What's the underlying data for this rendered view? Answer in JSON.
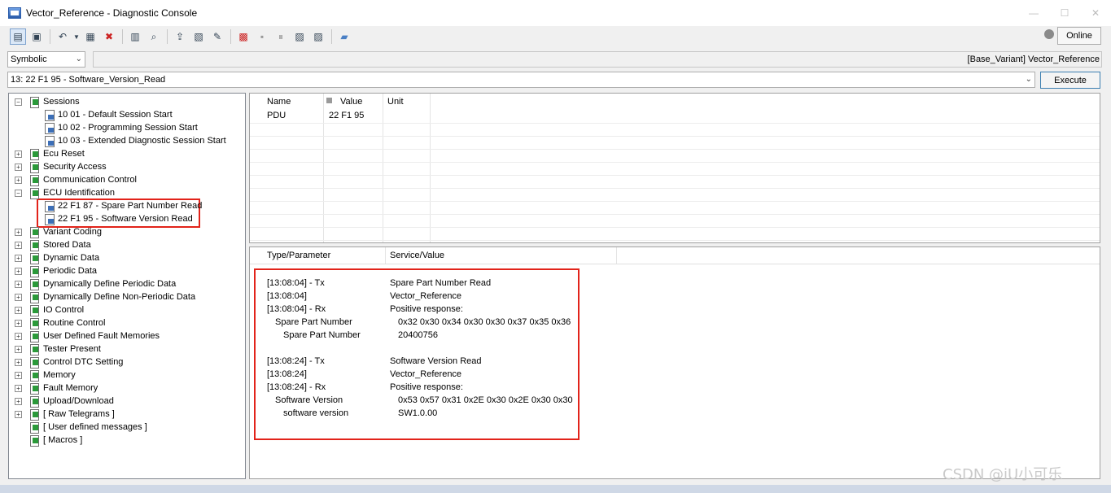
{
  "window": {
    "title": "Vector_Reference - Diagnostic Console"
  },
  "toolbar": {
    "online_label": "Online"
  },
  "selector": {
    "mode": "Symbolic",
    "variant_path": "[Base_Variant] Vector_Reference"
  },
  "service": {
    "current": "13: 22 F1 95 - Software_Version_Read",
    "execute_label": "Execute"
  },
  "tree": [
    {
      "label": "Sessions",
      "level": 0,
      "kind": "folder",
      "expander": "minus"
    },
    {
      "label": "10 01 - Default Session Start",
      "level": 1,
      "kind": "service",
      "expander": ""
    },
    {
      "label": "10 02 - Programming Session Start",
      "level": 1,
      "kind": "service",
      "expander": ""
    },
    {
      "label": "10 03 - Extended Diagnostic Session Start",
      "level": 1,
      "kind": "service",
      "expander": ""
    },
    {
      "label": "Ecu Reset",
      "level": 0,
      "kind": "folder",
      "expander": "plus"
    },
    {
      "label": "Security Access",
      "level": 0,
      "kind": "folder",
      "expander": "plus"
    },
    {
      "label": "Communication Control",
      "level": 0,
      "kind": "folder",
      "expander": "plus"
    },
    {
      "label": "ECU Identification",
      "level": 0,
      "kind": "folder",
      "expander": "minus"
    },
    {
      "label": "22 F1 87 - Spare Part Number Read",
      "level": 1,
      "kind": "service",
      "expander": ""
    },
    {
      "label": "22 F1 95 - Software Version Read",
      "level": 1,
      "kind": "service",
      "expander": ""
    },
    {
      "label": "Variant Coding",
      "level": 0,
      "kind": "folder",
      "expander": "plus"
    },
    {
      "label": "Stored Data",
      "level": 0,
      "kind": "folder",
      "expander": "plus"
    },
    {
      "label": "Dynamic Data",
      "level": 0,
      "kind": "folder",
      "expander": "plus"
    },
    {
      "label": "Periodic Data",
      "level": 0,
      "kind": "folder",
      "expander": "plus"
    },
    {
      "label": "Dynamically Define Periodic Data",
      "level": 0,
      "kind": "folder",
      "expander": "plus"
    },
    {
      "label": "Dynamically Define Non-Periodic Data",
      "level": 0,
      "kind": "folder",
      "expander": "plus"
    },
    {
      "label": "IO Control",
      "level": 0,
      "kind": "folder",
      "expander": "plus"
    },
    {
      "label": "Routine Control",
      "level": 0,
      "kind": "folder",
      "expander": "plus"
    },
    {
      "label": "User Defined Fault Memories",
      "level": 0,
      "kind": "folder",
      "expander": "plus"
    },
    {
      "label": "Tester Present",
      "level": 0,
      "kind": "folder",
      "expander": "plus"
    },
    {
      "label": "Control DTC Setting",
      "level": 0,
      "kind": "folder",
      "expander": "plus"
    },
    {
      "label": "Memory",
      "level": 0,
      "kind": "folder",
      "expander": "plus"
    },
    {
      "label": "Fault Memory",
      "level": 0,
      "kind": "folder",
      "expander": "plus"
    },
    {
      "label": "Upload/Download",
      "level": 0,
      "kind": "folder",
      "expander": "plus"
    },
    {
      "label": "[ Raw Telegrams ]",
      "level": 0,
      "kind": "folder",
      "expander": "plus"
    },
    {
      "label": "[ User defined messages ]",
      "level": 0,
      "kind": "folder",
      "expander": ""
    },
    {
      "label": "[ Macros ]",
      "level": 0,
      "kind": "folder",
      "expander": ""
    }
  ],
  "params_table": {
    "headers": [
      "Name",
      "Value",
      "Unit"
    ],
    "rows": [
      {
        "name": "PDU",
        "value": "22 F1 95",
        "unit": ""
      }
    ]
  },
  "log_table": {
    "headers": [
      "Type/Parameter",
      "Service/Value"
    ],
    "rows": [
      {
        "param": "[13:08:04] - Tx",
        "value": "Spare Part Number Read",
        "indent": 0
      },
      {
        "param": "[13:08:04]",
        "value": "Vector_Reference",
        "indent": 0
      },
      {
        "param": "[13:08:04] - Rx",
        "value": "Positive response:",
        "indent": 0
      },
      {
        "param": "Spare Part Number",
        "value": "0x32 0x30 0x34 0x30 0x30 0x37 0x35 0x36",
        "indent": 1
      },
      {
        "param": "Spare Part Number",
        "value": "20400756",
        "indent": 2
      },
      {
        "param": "",
        "value": "",
        "indent": 0
      },
      {
        "param": "[13:08:24] - Tx",
        "value": "Software Version Read",
        "indent": 0
      },
      {
        "param": "[13:08:24]",
        "value": "Vector_Reference",
        "indent": 0
      },
      {
        "param": "[13:08:24] - Rx",
        "value": "Positive response:",
        "indent": 0
      },
      {
        "param": "Software Version",
        "value": "0x53 0x57 0x31 0x2E 0x30 0x2E 0x30 0x30",
        "indent": 1
      },
      {
        "param": "software version",
        "value": "SW1.0.00",
        "indent": 2
      }
    ]
  },
  "watermark": "CSDN @iU小可乐"
}
